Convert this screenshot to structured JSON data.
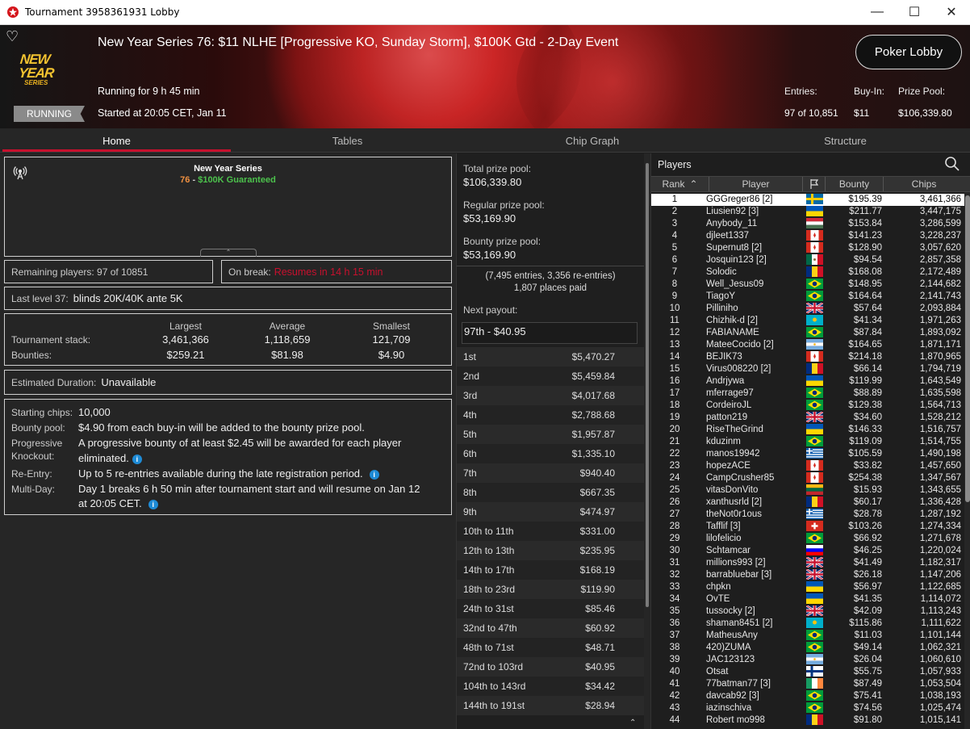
{
  "window": {
    "title": "Tournament 3958361931 Lobby",
    "minimize": "—",
    "maximize": "☐",
    "close": "✕"
  },
  "banner": {
    "title": "New Year Series 76: $11 NLHE [Progressive KO, Sunday Storm], $100K Gtd - 2-Day Event",
    "logo_line1": "NEW YEAR",
    "logo_line2": "SERIES",
    "status": "RUNNING",
    "running_for": "Running for 9 h 45 min",
    "started": "Started at 20:05 CET, Jan 11",
    "poker_lobby_button": "Poker Lobby",
    "entries_label": "Entries:",
    "entries_value": "97 of 10,851",
    "buyin_label": "Buy-In:",
    "buyin_value": "$11",
    "prize_label": "Prize Pool:",
    "prize_value": "$106,339.80"
  },
  "tabs": [
    "Home",
    "Tables",
    "Chip Graph",
    "Structure"
  ],
  "home": {
    "series_name": "New Year Series",
    "series_num": "76",
    "series_sep": " - ",
    "series_gtd": "$100K Guaranteed",
    "remaining": "Remaining players: 97 of 10851",
    "on_break_label": "On break:",
    "on_break_value": "Resumes in 14 h 15 min",
    "last_level_label": "Last level 37:",
    "last_level_value": "blinds 20K/40K ante 5K",
    "stats": {
      "col_largest": "Largest",
      "col_average": "Average",
      "col_smallest": "Smallest",
      "row1_label": "Tournament stack:",
      "row1": [
        "3,461,366",
        "1,118,659",
        "121,709"
      ],
      "row2_label": "Bounties:",
      "row2": [
        "$259.21",
        "$81.98",
        "$4.90"
      ]
    },
    "duration_label": "Estimated Duration:",
    "duration_value": "Unavailable",
    "info": {
      "starting_label": "Starting chips:",
      "starting_value": "10,000",
      "bounty_label": "Bounty pool:",
      "bounty_value": "$4.90 from each buy-in will be added to the bounty prize pool.",
      "pko_label1": "Progressive",
      "pko_label2": "Knockout:",
      "pko_value1": "A progressive bounty of at least $2.45 will be awarded for each player",
      "pko_value2": "eliminated.",
      "reentry_label": "Re-Entry:",
      "reentry_value": "Up to 5 re-entries available during the late registration period.",
      "multiday_label": "Multi-Day:",
      "multiday_value1": "Day 1 breaks 6 h 50 min after tournament start and will resume on Jan 12",
      "multiday_value2": "at 20:05 CET."
    }
  },
  "prizes": {
    "total_label": "Total prize pool:",
    "total_value": "$106,339.80",
    "regular_label": "Regular prize pool:",
    "regular_value": "$53,169.90",
    "bounty_label": "Bounty prize pool:",
    "bounty_value": "$53,169.90",
    "entries_note": "(7,495 entries, 3,356 re-entries)",
    "places_paid": "1,807 places paid",
    "next_payout_label": "Next payout:",
    "next_payout_value": "97th - $40.95",
    "payouts": [
      [
        "1st",
        "$5,470.27"
      ],
      [
        "2nd",
        "$5,459.84"
      ],
      [
        "3rd",
        "$4,017.68"
      ],
      [
        "4th",
        "$2,788.68"
      ],
      [
        "5th",
        "$1,957.87"
      ],
      [
        "6th",
        "$1,335.10"
      ],
      [
        "7th",
        "$940.40"
      ],
      [
        "8th",
        "$667.35"
      ],
      [
        "9th",
        "$474.97"
      ],
      [
        "10th to 11th",
        "$331.00"
      ],
      [
        "12th to 13th",
        "$235.95"
      ],
      [
        "14th to 17th",
        "$168.19"
      ],
      [
        "18th to 23rd",
        "$119.90"
      ],
      [
        "24th to 31st",
        "$85.46"
      ],
      [
        "32nd to 47th",
        "$60.92"
      ],
      [
        "48th to 71st",
        "$48.71"
      ],
      [
        "72nd to 103rd",
        "$40.95"
      ],
      [
        "104th to 143rd",
        "$34.42"
      ],
      [
        "144th to 191st",
        "$28.94"
      ]
    ]
  },
  "players": {
    "title": "Players",
    "columns": [
      "Rank",
      "Player",
      "Bounty",
      "Chips"
    ],
    "rows": [
      [
        "1",
        "GGGreger86 [2]",
        "se",
        "$195.39",
        "3,461,366"
      ],
      [
        "2",
        "Liusien92 [3]",
        "ua",
        "$211.77",
        "3,447,175"
      ],
      [
        "3",
        "Anybody_11",
        "hu",
        "$153.84",
        "3,286,599"
      ],
      [
        "4",
        "djleet1337",
        "ca",
        "$141.23",
        "3,228,237"
      ],
      [
        "5",
        "Supernut8 [2]",
        "ca",
        "$128.90",
        "3,057,620"
      ],
      [
        "6",
        "Josquin123 [2]",
        "mx",
        "$94.54",
        "2,857,358"
      ],
      [
        "7",
        "Solodic",
        "ro",
        "$168.08",
        "2,172,489"
      ],
      [
        "8",
        "Well_Jesus09",
        "br",
        "$148.95",
        "2,144,682"
      ],
      [
        "9",
        "TiagoY",
        "br",
        "$164.64",
        "2,141,743"
      ],
      [
        "10",
        "Pilliniho",
        "gb",
        "$57.64",
        "2,093,884"
      ],
      [
        "11",
        "Chizhik-d [2]",
        "kz",
        "$41.34",
        "1,971,263"
      ],
      [
        "12",
        "FABIANAME",
        "br",
        "$87.84",
        "1,893,092"
      ],
      [
        "13",
        "MateeCocido [2]",
        "ar",
        "$164.65",
        "1,871,171"
      ],
      [
        "14",
        "BEJIK73",
        "ca",
        "$214.18",
        "1,870,965"
      ],
      [
        "15",
        "Virus008220 [2]",
        "ro",
        "$66.14",
        "1,794,719"
      ],
      [
        "16",
        "Andrjywa",
        "ua",
        "$119.99",
        "1,643,549"
      ],
      [
        "17",
        "mferrage97",
        "br",
        "$88.89",
        "1,635,598"
      ],
      [
        "18",
        "CordeiroJL",
        "br",
        "$129.38",
        "1,564,713"
      ],
      [
        "19",
        "patton219",
        "gb",
        "$34.60",
        "1,528,212"
      ],
      [
        "20",
        "RiseTheGrind",
        "ua",
        "$146.33",
        "1,516,757"
      ],
      [
        "21",
        "kduzinm",
        "br",
        "$119.09",
        "1,514,755"
      ],
      [
        "22",
        "manos19942",
        "gr",
        "$105.59",
        "1,490,198"
      ],
      [
        "23",
        "hopezACE",
        "ca",
        "$33.82",
        "1,457,650"
      ],
      [
        "24",
        "CampCrusher85",
        "ca",
        "$254.38",
        "1,347,567"
      ],
      [
        "25",
        "vitasDonVito",
        "lt",
        "$15.93",
        "1,343,655"
      ],
      [
        "26",
        "xanthusrld [2]",
        "ro",
        "$60.17",
        "1,336,428"
      ],
      [
        "27",
        "theNot0r1ous",
        "gr",
        "$28.78",
        "1,287,192"
      ],
      [
        "28",
        "Tafflif [3]",
        "ch",
        "$103.26",
        "1,274,334"
      ],
      [
        "29",
        "lilofelicio",
        "br",
        "$66.92",
        "1,271,678"
      ],
      [
        "30",
        "Schtamcar",
        "si",
        "$46.25",
        "1,220,024"
      ],
      [
        "31",
        "millions993 [2]",
        "gb",
        "$41.49",
        "1,182,317"
      ],
      [
        "32",
        "barrabluebar [3]",
        "gb",
        "$26.18",
        "1,147,206"
      ],
      [
        "33",
        "chpkn",
        "ua",
        "$56.97",
        "1,122,685"
      ],
      [
        "34",
        "OvTE",
        "ua",
        "$41.35",
        "1,114,072"
      ],
      [
        "35",
        "tussocky [2]",
        "gb",
        "$42.09",
        "1,113,243"
      ],
      [
        "36",
        "shaman8451 [2]",
        "kz",
        "$115.86",
        "1,111,622"
      ],
      [
        "37",
        "MatheusAny",
        "br",
        "$11.03",
        "1,101,144"
      ],
      [
        "38",
        "420)ZUMA",
        "br",
        "$49.14",
        "1,062,321"
      ],
      [
        "39",
        "JAC123123",
        "ar",
        "$26.04",
        "1,060,610"
      ],
      [
        "40",
        "Otsat",
        "fi",
        "$55.75",
        "1,057,933"
      ],
      [
        "41",
        "77batman77 [3]",
        "ie",
        "$87.49",
        "1,053,504"
      ],
      [
        "42",
        "davcab92 [3]",
        "br",
        "$75.41",
        "1,038,193"
      ],
      [
        "43",
        "iazinschiva",
        "br",
        "$74.56",
        "1,025,474"
      ],
      [
        "44",
        "Robert mo998",
        "ro",
        "$91.80",
        "1,015,141"
      ]
    ]
  }
}
